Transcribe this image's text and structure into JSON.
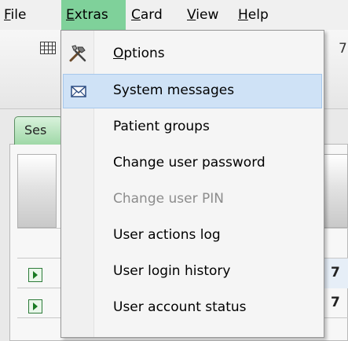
{
  "menubar": {
    "items": [
      {
        "prefix": "",
        "mnemonic": "F",
        "rest": "ile"
      },
      {
        "prefix": "",
        "mnemonic": "E",
        "rest": "xtras"
      },
      {
        "prefix": "",
        "mnemonic": "C",
        "rest": "ard"
      },
      {
        "prefix": "",
        "mnemonic": "V",
        "rest": "iew"
      },
      {
        "prefix": "",
        "mnemonic": "H",
        "rest": "elp"
      }
    ],
    "active": "Extras"
  },
  "toolbar": {
    "partial_text": "7"
  },
  "tab": {
    "label": "Ses"
  },
  "rows": [
    {
      "value": "7"
    },
    {
      "value": "7"
    }
  ],
  "extras_menu": {
    "items": [
      {
        "label": "Options",
        "mnemonic": "O",
        "rest": "ptions",
        "icon": "tools-icon",
        "enabled": true
      },
      {
        "label": "System messages",
        "icon": "envelope-icon",
        "enabled": true,
        "highlighted": true
      },
      {
        "label": "Patient groups",
        "enabled": true
      },
      {
        "label": "Change user password",
        "enabled": true
      },
      {
        "label": "Change user PIN",
        "enabled": false
      },
      {
        "label": "User actions log",
        "enabled": true
      },
      {
        "label": "User login history",
        "enabled": true
      },
      {
        "label": "User account status",
        "enabled": true
      }
    ]
  },
  "colors": {
    "menubar_active": "#7fd19a",
    "menu_highlight": "#cfe2f6",
    "disabled_text": "#8c8c8c"
  }
}
